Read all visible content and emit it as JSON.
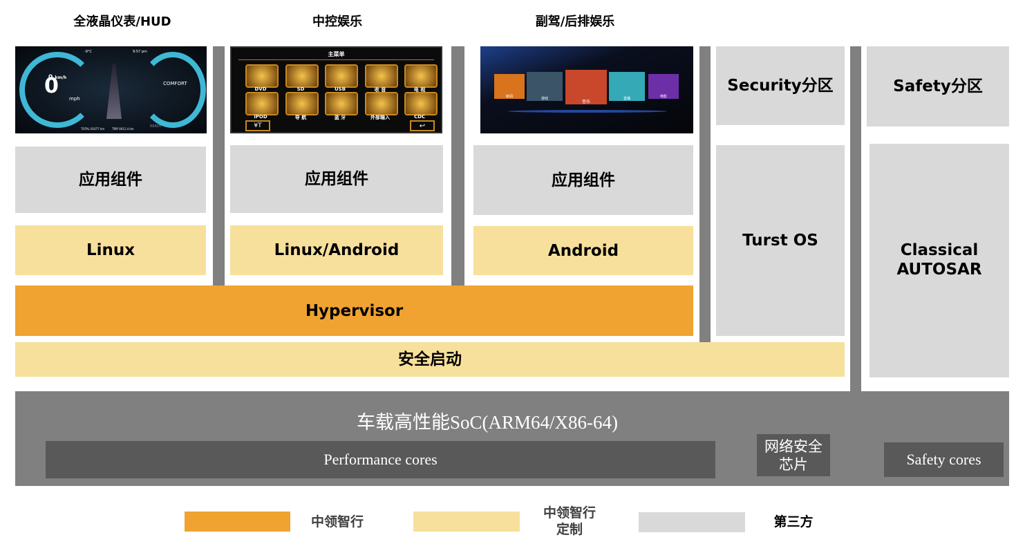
{
  "columns": [
    {
      "title": "全液晶仪表/HUD",
      "app": "应用组件",
      "os": "Linux"
    },
    {
      "title": "中控娱乐",
      "app": "应用组件",
      "os": "Linux/Android"
    },
    {
      "title": "副驾/后排娱乐",
      "app": "应用组件",
      "os": "Android"
    }
  ],
  "cluster": {
    "speed": "0",
    "unit": "mph",
    "kmh": "0",
    "kmh_unit": "km/h",
    "mode": "COMFORT",
    "ticks": [
      "120",
      "160",
      "90",
      "60",
      "30",
      "0",
      "100",
      "50",
      "0"
    ],
    "total": "TOTAL 01077 km",
    "trip": "TRIP 0011.4 km",
    "ready": "READY",
    "temp": "-9°C",
    "time": "9:57 pm"
  },
  "menu": {
    "title": "主菜单",
    "items": [
      "DVD",
      "SD",
      "USB",
      "收 音",
      "电 视",
      "iPOD",
      "导 航",
      "蓝 牙",
      "外部输入",
      "CDC"
    ]
  },
  "rear": {
    "tiles": [
      "新闻",
      "游戏",
      "音乐",
      "直播",
      "电影"
    ]
  },
  "security": {
    "partition": "Security分区",
    "os": "Turst OS"
  },
  "safety": {
    "partition": "Safety分区",
    "os_line1": "Classical",
    "os_line2": "AUTOSAR"
  },
  "hypervisor": "Hypervisor",
  "secure_boot": "安全启动",
  "soc": {
    "title": "车载高性能SoC(ARM64/X86-64)",
    "perf": "Performance cores",
    "netsec_line1": "网络安全",
    "netsec_line2": "芯片",
    "safety_cores": "Safety cores"
  },
  "legend": [
    {
      "label": "中领智行",
      "color": "#F0A330"
    },
    {
      "label_line1": "中领智行",
      "label_line2": "定制",
      "color": "#F7E09C"
    },
    {
      "label": "第三方",
      "color": "#D9D9D9"
    }
  ]
}
